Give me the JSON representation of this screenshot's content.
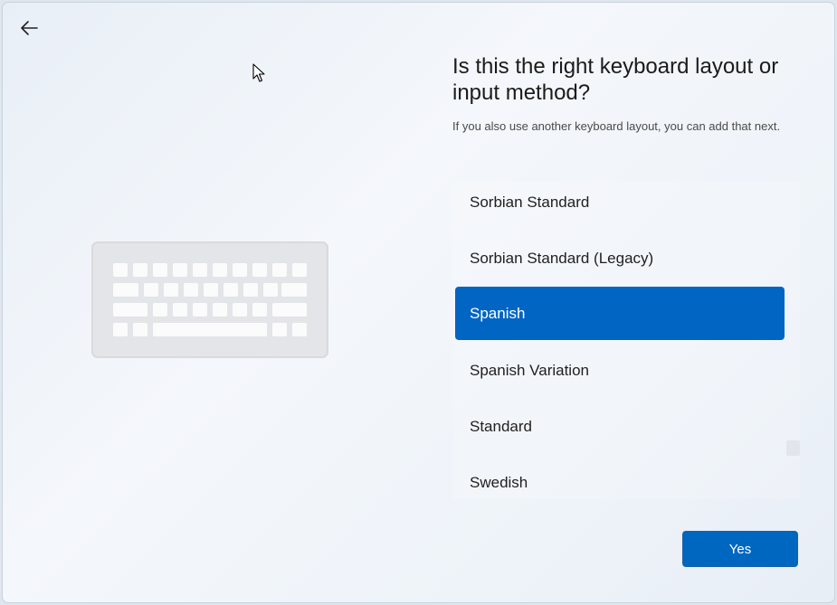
{
  "header": {
    "back_icon": "arrow-left-icon"
  },
  "main": {
    "title": "Is this the right keyboard layout or input method?",
    "subtitle": "If you also use another keyboard layout, you can add that next."
  },
  "layouts": {
    "items": [
      {
        "label": "Sorbian Standard",
        "selected": false
      },
      {
        "label": "Sorbian Standard (Legacy)",
        "selected": false
      },
      {
        "label": "Spanish",
        "selected": true
      },
      {
        "label": "Spanish Variation",
        "selected": false
      },
      {
        "label": "Standard",
        "selected": false
      },
      {
        "label": "Swedish",
        "selected": false
      }
    ]
  },
  "footer": {
    "yes_label": "Yes"
  },
  "colors": {
    "accent": "#0065c3",
    "text": "#1b1b1b"
  }
}
